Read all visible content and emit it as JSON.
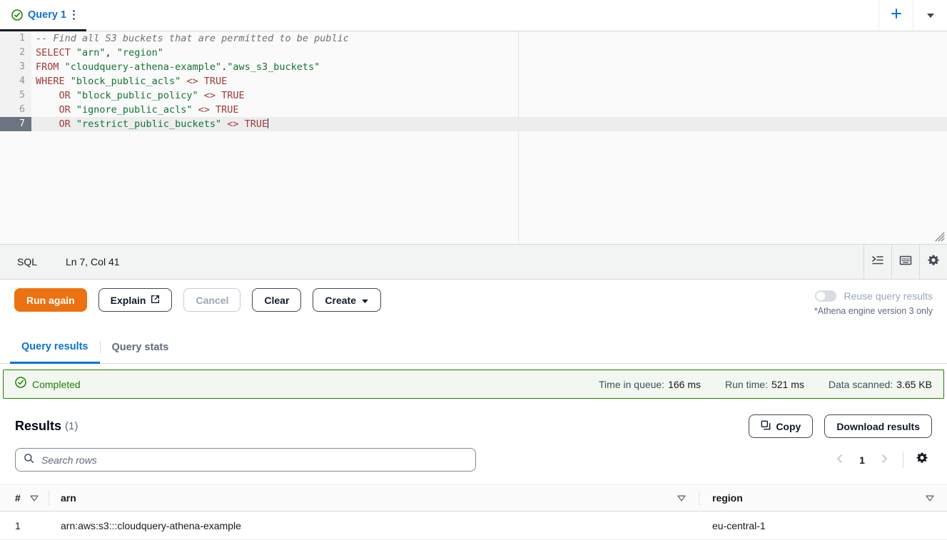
{
  "tabstrip": {
    "query_tab": {
      "label": "Query 1",
      "status_icon": "check-circle-icon",
      "menu_icon": "kebab-menu-icon"
    },
    "add_tab_icon": "plus-icon",
    "tab_list_icon": "caret-down-icon"
  },
  "editor": {
    "lines": [
      {
        "num": "1",
        "tokens": [
          {
            "t": "comment",
            "v": "-- Find all S3 buckets that are permitted to be public"
          }
        ]
      },
      {
        "num": "2",
        "tokens": [
          {
            "t": "kw",
            "v": "SELECT "
          },
          {
            "t": "str",
            "v": "\"arn\""
          },
          {
            "t": "plain",
            "v": ", "
          },
          {
            "t": "str",
            "v": "\"region\""
          }
        ]
      },
      {
        "num": "3",
        "tokens": [
          {
            "t": "kw",
            "v": "FROM "
          },
          {
            "t": "str",
            "v": "\"cloudquery-athena-example\""
          },
          {
            "t": "plain",
            "v": "."
          },
          {
            "t": "str",
            "v": "\"aws_s3_buckets\""
          }
        ]
      },
      {
        "num": "4",
        "tokens": [
          {
            "t": "kw",
            "v": "WHERE "
          },
          {
            "t": "str",
            "v": "\"block_public_acls\""
          },
          {
            "t": "op",
            "v": " <> "
          },
          {
            "t": "kw",
            "v": "TRUE"
          }
        ]
      },
      {
        "num": "5",
        "tokens": [
          {
            "t": "kw",
            "v": "    OR "
          },
          {
            "t": "str",
            "v": "\"block_public_policy\""
          },
          {
            "t": "op",
            "v": " <> "
          },
          {
            "t": "kw",
            "v": "TRUE"
          }
        ]
      },
      {
        "num": "6",
        "tokens": [
          {
            "t": "kw",
            "v": "    OR "
          },
          {
            "t": "str",
            "v": "\"ignore_public_acls\""
          },
          {
            "t": "op",
            "v": " <> "
          },
          {
            "t": "kw",
            "v": "TRUE"
          }
        ]
      },
      {
        "num": "7",
        "active": true,
        "caret": true,
        "tokens": [
          {
            "t": "kw",
            "v": "    OR "
          },
          {
            "t": "str",
            "v": "\"restrict_public_buckets\""
          },
          {
            "t": "op",
            "v": " <> "
          },
          {
            "t": "kw",
            "v": "TRUE"
          }
        ]
      }
    ],
    "resize_handle_icon": "resize-grip-icon"
  },
  "statusbar": {
    "language": "SQL",
    "cursor_position": "Ln 7, Col 41",
    "format_icon": "format-indent-icon",
    "shortcuts_icon": "keyboard-icon",
    "settings_icon": "gear-icon"
  },
  "actions": {
    "run_again": "Run again",
    "explain": "Explain",
    "explain_icon": "external-link-icon",
    "cancel": "Cancel",
    "clear": "Clear",
    "create": "Create",
    "create_caret_icon": "caret-down-icon",
    "reuse_toggle_label": "Reuse query results",
    "reuse_toggle_state": "off",
    "engine_note": "*Athena engine version 3 only"
  },
  "result_tabs": [
    {
      "label": "Query results",
      "active": true
    },
    {
      "label": "Query stats",
      "active": false
    }
  ],
  "banner": {
    "status_icon": "check-circle-icon",
    "status": "Completed",
    "metrics": [
      {
        "label": "Time in queue:",
        "value": "166 ms"
      },
      {
        "label": "Run time:",
        "value": "521 ms"
      },
      {
        "label": "Data scanned:",
        "value": "3.65 KB"
      }
    ]
  },
  "results": {
    "title": "Results",
    "count": "(1)",
    "copy_label": "Copy",
    "copy_icon": "copy-icon",
    "download_label": "Download results",
    "search_placeholder": "Search rows",
    "search_value": "",
    "search_icon": "search-icon",
    "prev_icon": "chevron-left-icon",
    "next_icon": "chevron-right-icon",
    "page": "1",
    "preferences_icon": "gear-icon",
    "columns": [
      {
        "key": "idx",
        "label": "#",
        "filter_icon": "filter-triangle-icon"
      },
      {
        "key": "arn",
        "label": "arn",
        "filter_icon": "filter-triangle-icon"
      },
      {
        "key": "region",
        "label": "region",
        "filter_icon": "filter-triangle-icon"
      }
    ],
    "rows": [
      {
        "idx": "1",
        "arn": "arn:aws:s3:::cloudquery-athena-example",
        "region": "eu-central-1"
      }
    ]
  },
  "colors": {
    "accent_blue": "#0972d3",
    "primary_orange": "#ec7211",
    "success_green": "#1d8102"
  }
}
